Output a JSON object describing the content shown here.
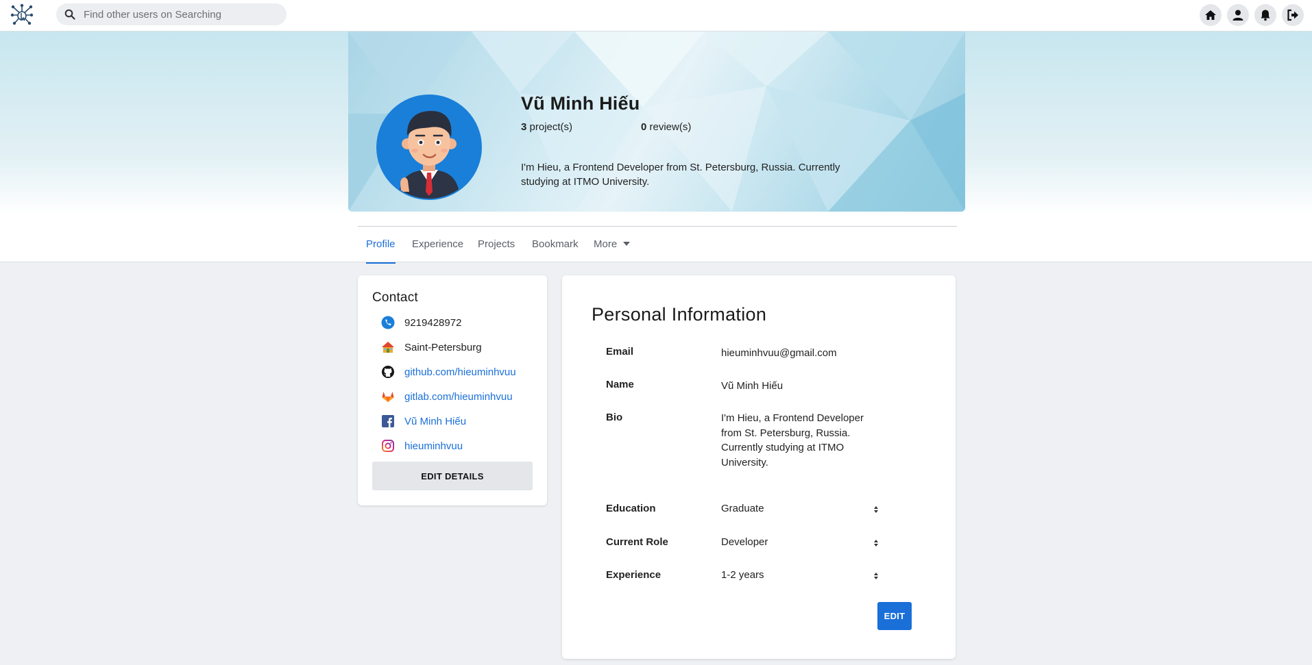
{
  "search": {
    "placeholder": "Find other users on Searching"
  },
  "nav": {
    "icons": [
      "home-icon",
      "user-icon",
      "bell-icon",
      "logout-icon"
    ]
  },
  "profile": {
    "name": "Vũ Minh Hiếu",
    "projects_count": "3",
    "projects_label": "project(s)",
    "reviews_count": "0",
    "reviews_label": "review(s)",
    "bio": "I'm Hieu, a Frontend Developer from St. Petersburg, Russia. Currently studying at ITMO University."
  },
  "tabs": [
    {
      "label": "Profile",
      "active": true
    },
    {
      "label": "Experience",
      "active": false
    },
    {
      "label": "Projects",
      "active": false
    },
    {
      "label": "Bookmark",
      "active": false
    },
    {
      "label": "More",
      "active": false
    }
  ],
  "contact": {
    "title": "Contact",
    "phone": "9219428972",
    "city": "Saint-Petersburg",
    "github": "github.com/hieuminhvuu",
    "gitlab": "gitlab.com/hieuminhvuu",
    "facebook": "Vũ Minh Hiếu",
    "instagram": "hieuminhvuu",
    "edit_label": "EDIT DETAILS"
  },
  "info": {
    "title": "Personal Information",
    "email_label": "Email",
    "email": "hieuminhvuu@gmail.com",
    "name_label": "Name",
    "name": "Vũ Minh Hiếu",
    "bio_label": "Bio",
    "bio": "I'm Hieu, a Frontend Developer from St. Petersburg, Russia. Currently studying at ITMO University.",
    "education_label": "Education",
    "education": "Graduate",
    "role_label": "Current Role",
    "role": "Developer",
    "experience_label": "Experience",
    "experience": "1-2 years",
    "edit_label": "EDIT"
  },
  "colors": {
    "accent": "#1a6fd9",
    "avatar_bg": "#1a7fd9"
  }
}
